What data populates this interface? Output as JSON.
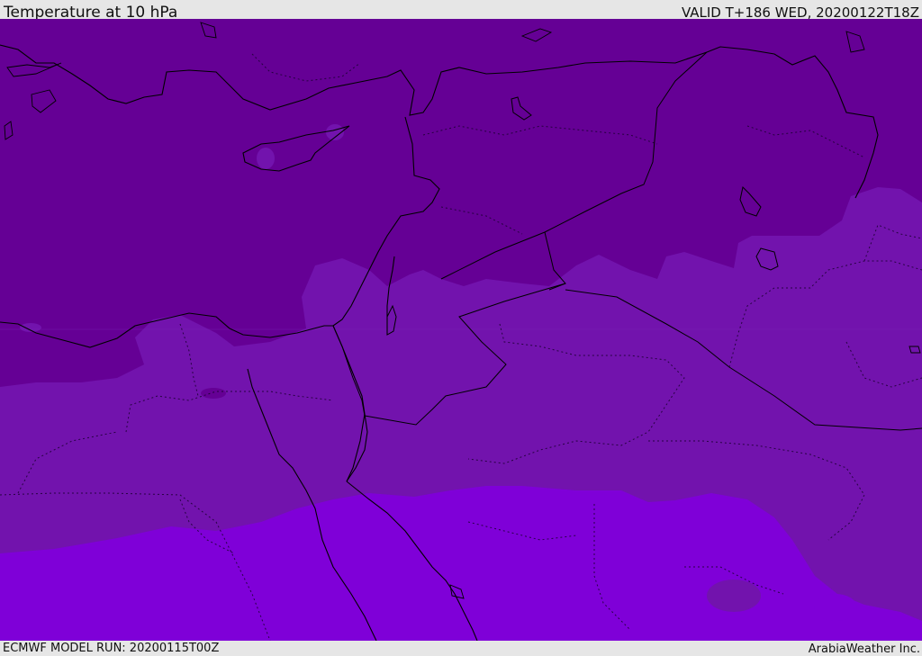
{
  "header": {
    "title": "Temperature at 10 hPa",
    "valid_time": "VALID T+186 WED, 20200122T18Z"
  },
  "footer": {
    "model_run": "ECMWF MODEL RUN: 20200115T00Z",
    "credit": "ArabiaWeather Inc."
  },
  "map": {
    "variable": "temperature",
    "level": "10 hPa",
    "colors": {
      "coldest": "#650095",
      "cold": "#7213ad",
      "warm": "#7f00d8",
      "boundary": "#000000"
    }
  }
}
